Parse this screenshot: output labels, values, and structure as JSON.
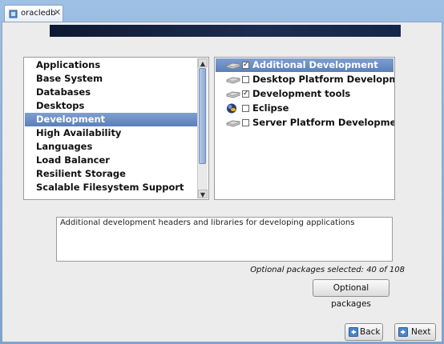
{
  "tab": {
    "label": "oracledb",
    "close": "✕"
  },
  "groups": {
    "items": [
      "Applications",
      "Base System",
      "Databases",
      "Desktops",
      "Development",
      "High Availability",
      "Languages",
      "Load Balancer",
      "Resilient Storage",
      "Scalable Filesystem Support"
    ],
    "selected_index": 4
  },
  "packages": {
    "items": [
      {
        "label": "Additional Development",
        "checked": true,
        "icon": "drive-icon",
        "selected": true
      },
      {
        "label": "Desktop Platform Development",
        "checked": false,
        "icon": "drive-icon",
        "selected": false
      },
      {
        "label": "Development tools",
        "checked": true,
        "icon": "drive-icon",
        "selected": false
      },
      {
        "label": "Eclipse",
        "checked": false,
        "icon": "eclipse-globe-icon",
        "selected": false
      },
      {
        "label": "Server Platform Development",
        "checked": false,
        "icon": "drive-icon",
        "selected": false
      }
    ]
  },
  "description": "Additional development headers and libraries for developing applications",
  "optional_count": "Optional packages selected: 40 of 108",
  "buttons": {
    "optional_packages": "Optional packages",
    "back": "Back",
    "next": "Next"
  },
  "colors": {
    "selection": "#5a7fb8",
    "banner": "#16264a"
  }
}
